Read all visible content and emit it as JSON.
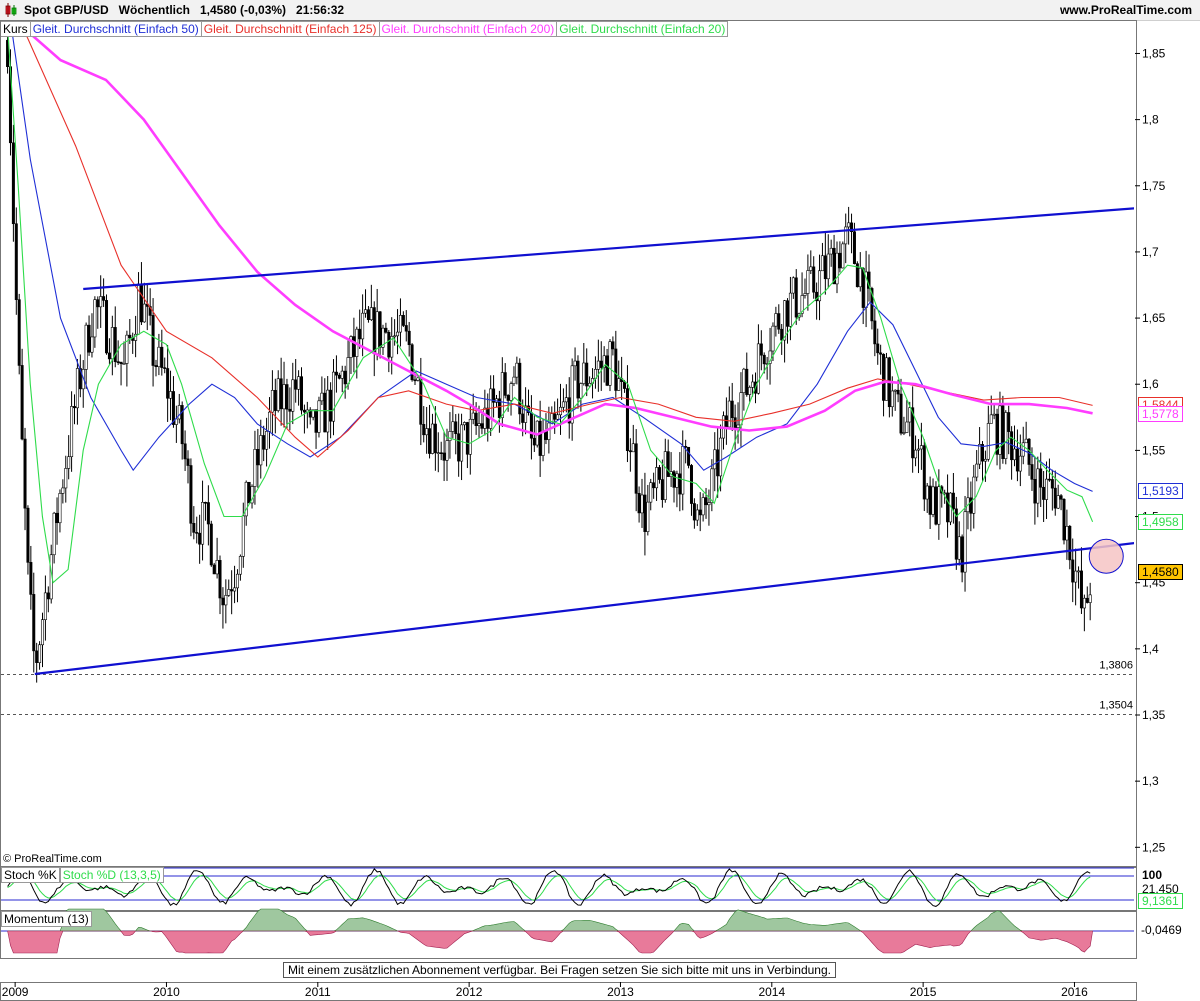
{
  "header": {
    "title": "Spot GBP/USD   Wöchentlich   1,4580 (-0,03%)   21:56:32",
    "brand": "www.ProRealTime.com"
  },
  "copyright": "© ProRealTime.com",
  "notice": "Mit einem zusätzlichen Abonnement verfügbar. Bei Fragen setzen Sie sich bitte mit uns in Verbindung.",
  "colors": {
    "sma50": "#1f2fd6",
    "sma125": "#e8302a",
    "sma200": "#ff3dff",
    "sma20": "#2fdc4b",
    "trendline": "#1010d0",
    "target_circle": "#f6c4c4",
    "momentum_pos": "#9fc79f",
    "momentum_neg": "#e87a9a"
  },
  "chart_data": [
    {
      "type": "candlestick",
      "panel": "price",
      "legend": [
        {
          "name": "Kurs",
          "color": "#000000"
        },
        {
          "name": "Gleit. Durchschnitt (Einfach 50)",
          "color": "#1f2fd6"
        },
        {
          "name": "Gleit. Durchschnitt (Einfach 125)",
          "color": "#e8302a"
        },
        {
          "name": "Gleit. Durchschnitt (Einfach 200)",
          "color": "#ff3dff"
        },
        {
          "name": "Gleit. Durchschnitt (Einfach 20)",
          "color": "#2fdc4b"
        }
      ],
      "ylim": [
        1.22,
        1.87
      ],
      "y_ticks": [
        "1,85",
        "1,8",
        "1,75",
        "1,7",
        "1,65",
        "1,6",
        "1,55",
        "1,5",
        "1,45",
        "1,4",
        "1,35",
        "1,3",
        "1,25"
      ],
      "x_ticks": [
        "2009",
        "2010",
        "2011",
        "2012",
        "2013",
        "2014",
        "2015",
        "2016"
      ],
      "xlim": [
        2008.9,
        2016.4
      ],
      "close_anchors": [
        [
          2008.95,
          1.86
        ],
        [
          2009.02,
          1.62
        ],
        [
          2009.08,
          1.46
        ],
        [
          2009.13,
          1.385
        ],
        [
          2009.2,
          1.44
        ],
        [
          2009.3,
          1.52
        ],
        [
          2009.42,
          1.6
        ],
        [
          2009.52,
          1.66
        ],
        [
          2009.62,
          1.64
        ],
        [
          2009.72,
          1.61
        ],
        [
          2009.82,
          1.67
        ],
        [
          2009.92,
          1.62
        ],
        [
          2010.0,
          1.6
        ],
        [
          2010.1,
          1.56
        ],
        [
          2010.18,
          1.5
        ],
        [
          2010.28,
          1.49
        ],
        [
          2010.38,
          1.44
        ],
        [
          2010.45,
          1.46
        ],
        [
          2010.55,
          1.52
        ],
        [
          2010.7,
          1.58
        ],
        [
          2010.85,
          1.6
        ],
        [
          2010.95,
          1.56
        ],
        [
          2011.1,
          1.59
        ],
        [
          2011.3,
          1.64
        ],
        [
          2011.45,
          1.64
        ],
        [
          2011.6,
          1.63
        ],
        [
          2011.72,
          1.57
        ],
        [
          2011.85,
          1.55
        ],
        [
          2012.0,
          1.56
        ],
        [
          2012.15,
          1.58
        ],
        [
          2012.3,
          1.61
        ],
        [
          2012.42,
          1.55
        ],
        [
          2012.55,
          1.56
        ],
        [
          2012.7,
          1.6
        ],
        [
          2012.82,
          1.61
        ],
        [
          2012.95,
          1.62
        ],
        [
          2013.08,
          1.55
        ],
        [
          2013.15,
          1.5
        ],
        [
          2013.3,
          1.53
        ],
        [
          2013.45,
          1.54
        ],
        [
          2013.52,
          1.49
        ],
        [
          2013.6,
          1.52
        ],
        [
          2013.72,
          1.58
        ],
        [
          2013.85,
          1.6
        ],
        [
          2013.95,
          1.63
        ],
        [
          2014.1,
          1.66
        ],
        [
          2014.25,
          1.67
        ],
        [
          2014.38,
          1.69
        ],
        [
          2014.5,
          1.71
        ],
        [
          2014.6,
          1.68
        ],
        [
          2014.7,
          1.62
        ],
        [
          2014.82,
          1.58
        ],
        [
          2014.95,
          1.56
        ],
        [
          2015.05,
          1.51
        ],
        [
          2015.18,
          1.5
        ],
        [
          2015.25,
          1.47
        ],
        [
          2015.35,
          1.53
        ],
        [
          2015.45,
          1.57
        ],
        [
          2015.55,
          1.56
        ],
        [
          2015.65,
          1.55
        ],
        [
          2015.78,
          1.52
        ],
        [
          2015.88,
          1.52
        ],
        [
          2015.95,
          1.49
        ],
        [
          2016.02,
          1.45
        ],
        [
          2016.06,
          1.42
        ],
        [
          2016.1,
          1.45
        ],
        [
          2016.12,
          1.458
        ]
      ],
      "series": [
        {
          "name": "Gleit. Durchschnitt (Einfach 50)",
          "last": 1.5193,
          "points": [
            [
              2008.95,
              1.89
            ],
            [
              2009.1,
              1.77
            ],
            [
              2009.3,
              1.65
            ],
            [
              2009.5,
              1.59
            ],
            [
              2009.7,
              1.55
            ],
            [
              2009.78,
              1.535
            ],
            [
              2009.95,
              1.56
            ],
            [
              2010.15,
              1.585
            ],
            [
              2010.3,
              1.6
            ],
            [
              2010.45,
              1.59
            ],
            [
              2010.6,
              1.57
            ],
            [
              2010.8,
              1.555
            ],
            [
              2010.95,
              1.545
            ],
            [
              2011.15,
              1.56
            ],
            [
              2011.4,
              1.59
            ],
            [
              2011.65,
              1.61
            ],
            [
              2011.85,
              1.6
            ],
            [
              2012.05,
              1.59
            ],
            [
              2012.3,
              1.585
            ],
            [
              2012.55,
              1.57
            ],
            [
              2012.75,
              1.585
            ],
            [
              2012.95,
              1.59
            ],
            [
              2013.15,
              1.575
            ],
            [
              2013.4,
              1.555
            ],
            [
              2013.55,
              1.535
            ],
            [
              2013.7,
              1.545
            ],
            [
              2013.9,
              1.56
            ],
            [
              2014.1,
              1.57
            ],
            [
              2014.3,
              1.6
            ],
            [
              2014.5,
              1.64
            ],
            [
              2014.65,
              1.662
            ],
            [
              2014.8,
              1.645
            ],
            [
              2014.95,
              1.61
            ],
            [
              2015.1,
              1.575
            ],
            [
              2015.25,
              1.555
            ],
            [
              2015.4,
              1.553
            ],
            [
              2015.55,
              1.556
            ],
            [
              2015.7,
              1.548
            ],
            [
              2015.85,
              1.535
            ],
            [
              2016.0,
              1.525
            ],
            [
              2016.12,
              1.519
            ]
          ]
        },
        {
          "name": "Gleit. Durchschnitt (Einfach 125)",
          "last": 1.5844,
          "points": [
            [
              2009.05,
              1.87
            ],
            [
              2009.4,
              1.78
            ],
            [
              2009.7,
              1.69
            ],
            [
              2010.0,
              1.64
            ],
            [
              2010.3,
              1.62
            ],
            [
              2010.6,
              1.59
            ],
            [
              2010.85,
              1.56
            ],
            [
              2011.0,
              1.545
            ],
            [
              2011.2,
              1.565
            ],
            [
              2011.4,
              1.59
            ],
            [
              2011.6,
              1.595
            ],
            [
              2011.85,
              1.585
            ],
            [
              2012.05,
              1.58
            ],
            [
              2012.3,
              1.585
            ],
            [
              2012.55,
              1.578
            ],
            [
              2012.8,
              1.585
            ],
            [
              2013.0,
              1.59
            ],
            [
              2013.25,
              1.585
            ],
            [
              2013.5,
              1.575
            ],
            [
              2013.75,
              1.572
            ],
            [
              2014.0,
              1.578
            ],
            [
              2014.25,
              1.585
            ],
            [
              2014.5,
              1.597
            ],
            [
              2014.7,
              1.604
            ],
            [
              2014.9,
              1.6
            ],
            [
              2015.15,
              1.594
            ],
            [
              2015.4,
              1.588
            ],
            [
              2015.65,
              1.59
            ],
            [
              2015.9,
              1.59
            ],
            [
              2016.12,
              1.584
            ]
          ]
        },
        {
          "name": "Gleit. Durchschnitt (Einfach 200)",
          "last": 1.5778,
          "points": [
            [
              2009.05,
              1.87
            ],
            [
              2009.3,
              1.845
            ],
            [
              2009.6,
              1.83
            ],
            [
              2009.85,
              1.8
            ],
            [
              2010.1,
              1.76
            ],
            [
              2010.35,
              1.72
            ],
            [
              2010.6,
              1.685
            ],
            [
              2010.85,
              1.66
            ],
            [
              2011.1,
              1.64
            ],
            [
              2011.35,
              1.625
            ],
            [
              2011.6,
              1.61
            ],
            [
              2011.85,
              1.595
            ],
            [
              2012.0,
              1.585
            ],
            [
              2012.2,
              1.57
            ],
            [
              2012.45,
              1.562
            ],
            [
              2012.7,
              1.575
            ],
            [
              2012.9,
              1.585
            ],
            [
              2013.1,
              1.582
            ],
            [
              2013.35,
              1.575
            ],
            [
              2013.6,
              1.568
            ],
            [
              2013.85,
              1.565
            ],
            [
              2014.1,
              1.568
            ],
            [
              2014.35,
              1.58
            ],
            [
              2014.55,
              1.595
            ],
            [
              2014.75,
              1.602
            ],
            [
              2014.95,
              1.6
            ],
            [
              2015.2,
              1.592
            ],
            [
              2015.45,
              1.585
            ],
            [
              2015.7,
              1.585
            ],
            [
              2015.95,
              1.582
            ],
            [
              2016.12,
              1.578
            ]
          ]
        },
        {
          "name": "Gleit. Durchschnitt (Einfach 20)",
          "last": 1.4958,
          "points": [
            [
              2008.95,
              1.87
            ],
            [
              2009.02,
              1.75
            ],
            [
              2009.1,
              1.6
            ],
            [
              2009.18,
              1.5
            ],
            [
              2009.25,
              1.45
            ],
            [
              2009.35,
              1.46
            ],
            [
              2009.45,
              1.55
            ],
            [
              2009.55,
              1.6
            ],
            [
              2009.7,
              1.63
            ],
            [
              2009.85,
              1.64
            ],
            [
              2010.0,
              1.63
            ],
            [
              2010.1,
              1.6
            ],
            [
              2010.25,
              1.54
            ],
            [
              2010.38,
              1.5
            ],
            [
              2010.5,
              1.5
            ],
            [
              2010.65,
              1.53
            ],
            [
              2010.8,
              1.57
            ],
            [
              2010.95,
              1.58
            ],
            [
              2011.1,
              1.58
            ],
            [
              2011.3,
              1.62
            ],
            [
              2011.5,
              1.635
            ],
            [
              2011.7,
              1.6
            ],
            [
              2011.85,
              1.56
            ],
            [
              2012.0,
              1.555
            ],
            [
              2012.15,
              1.565
            ],
            [
              2012.3,
              1.59
            ],
            [
              2012.45,
              1.575
            ],
            [
              2012.6,
              1.57
            ],
            [
              2012.75,
              1.59
            ],
            [
              2012.9,
              1.615
            ],
            [
              2013.05,
              1.6
            ],
            [
              2013.2,
              1.55
            ],
            [
              2013.35,
              1.53
            ],
            [
              2013.5,
              1.525
            ],
            [
              2013.62,
              1.51
            ],
            [
              2013.75,
              1.555
            ],
            [
              2013.9,
              1.6
            ],
            [
              2014.05,
              1.63
            ],
            [
              2014.2,
              1.655
            ],
            [
              2014.35,
              1.67
            ],
            [
              2014.5,
              1.69
            ],
            [
              2014.6,
              1.688
            ],
            [
              2014.72,
              1.65
            ],
            [
              2014.85,
              1.6
            ],
            [
              2015.0,
              1.56
            ],
            [
              2015.12,
              1.52
            ],
            [
              2015.22,
              1.5
            ],
            [
              2015.35,
              1.515
            ],
            [
              2015.48,
              1.55
            ],
            [
              2015.58,
              1.56
            ],
            [
              2015.7,
              1.55
            ],
            [
              2015.82,
              1.535
            ],
            [
              2015.95,
              1.52
            ],
            [
              2016.05,
              1.515
            ],
            [
              2016.12,
              1.496
            ]
          ]
        }
      ],
      "trendlines": [
        {
          "from": [
            2009.13,
            1.381
          ],
          "to": [
            2016.4,
            1.48
          ]
        },
        {
          "from": [
            2009.45,
            1.672
          ],
          "to": [
            2016.4,
            1.733
          ]
        }
      ],
      "support_levels": [
        {
          "value": 1.3806,
          "label": "1,3806"
        },
        {
          "value": 1.3504,
          "label": "1,3504"
        }
      ],
      "target_circle_center": [
        2016.21,
        1.47
      ],
      "price_tags": [
        {
          "value": 1.5844,
          "label": "1,5844",
          "color": "#e8302a"
        },
        {
          "value": 1.5778,
          "label": "1,5778",
          "color": "#ff3dff"
        },
        {
          "value": 1.5193,
          "label": "1,5193",
          "color": "#1f2fd6"
        },
        {
          "value": 1.4958,
          "label": "1,4958",
          "color": "#2fdc4b"
        },
        {
          "value": 1.458,
          "label": "1,4580",
          "color": "#000000",
          "fill": "#ffc400"
        }
      ]
    },
    {
      "type": "line",
      "panel": "stochastic",
      "legend": [
        {
          "name": "Stoch %K",
          "color": "#000000"
        },
        {
          "name": "Stoch %D (13,3,5)",
          "color": "#2fdc4b"
        }
      ],
      "ylim": [
        0,
        100
      ],
      "y_ticks": [
        "100"
      ],
      "levels": [
        80,
        20
      ],
      "last_k": "21,450",
      "last_d": "9,1361"
    },
    {
      "type": "area",
      "panel": "momentum",
      "legend": [
        {
          "name": "Momentum (13)",
          "color": "#000000"
        }
      ],
      "last": "-0,0469"
    }
  ]
}
